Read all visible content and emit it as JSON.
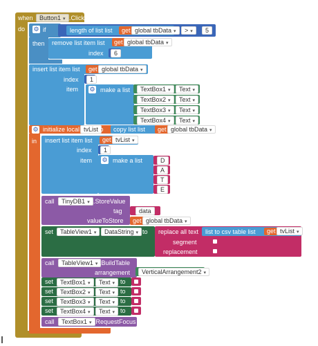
{
  "when_block": {
    "when_label": "when",
    "component": "Button1",
    "event": ".Click",
    "do_label": "do"
  },
  "if_block": {
    "if_label": "if",
    "then_label": "then"
  },
  "length_block": {
    "label": "length of list  list"
  },
  "get_label": "get",
  "global_tbData": "global tbData",
  "compare": {
    "op": ">",
    "value": "5"
  },
  "remove_block": {
    "label": "remove list item  list",
    "index_label": "index",
    "index_value": "6"
  },
  "insert1": {
    "label": "insert list item  list",
    "index_label": "index",
    "index_value": "1",
    "item_label": "item"
  },
  "make_list_label": "make a list",
  "textbox_rows": [
    {
      "component": "TextBox1",
      "prop": "Text"
    },
    {
      "component": "TextBox2",
      "prop": "Text"
    },
    {
      "component": "TextBox3",
      "prop": "Text"
    },
    {
      "component": "TextBox4",
      "prop": "Text"
    }
  ],
  "init_local": {
    "label": "initialize local",
    "var": "tvList",
    "to_label": "to",
    "copy_label": "copy list  list",
    "in_label": "in"
  },
  "insert2": {
    "label": "insert list item  list",
    "var": "tvList",
    "index_label": "index",
    "index_value": "1",
    "item_label": "item"
  },
  "letters": [
    "D",
    "A",
    "T",
    "E"
  ],
  "store_value": {
    "call_label": "call",
    "component": "TinyDB1",
    "method": ".StoreValue",
    "tag_label": "tag",
    "tag_value": "data",
    "value_label": "valueToStore"
  },
  "set_table": {
    "set_label": "set",
    "component": "TableView1",
    "prop": "DataString",
    "to_label": "to",
    "replace_label": "replace all text",
    "csv_label": "list to csv table  list",
    "var": "tvList",
    "segment_label": "segment",
    "replacement_label": "replacement"
  },
  "build_table": {
    "call_label": "call",
    "component": "TableView1",
    "method": ".BuildTable",
    "arrangement_label": "arrangement",
    "arrangement_value": "VerticalArrangement2"
  },
  "set_textboxes": [
    {
      "set_label": "set",
      "component": "TextBox1",
      "prop": "Text",
      "to_label": "to"
    },
    {
      "set_label": "set",
      "component": "TextBox2",
      "prop": "Text",
      "to_label": "to"
    },
    {
      "set_label": "set",
      "component": "TextBox3",
      "prop": "Text",
      "to_label": "to"
    },
    {
      "set_label": "set",
      "component": "TextBox4",
      "prop": "Text",
      "to_label": "to"
    }
  ],
  "focus": {
    "call_label": "call",
    "component": "TextBox1",
    "method": ".RequestFocus"
  },
  "colors": {
    "event": "#b08f2a",
    "control": "#4a8fc4",
    "list": "#4a9cd4",
    "variable": "#e3672e",
    "math": "#3a66b8",
    "component": "#3e8b5a",
    "text": "#c22d66",
    "procedure": "#8c5aa6",
    "dark_component": "#2b6d44",
    "db": "#7a4b91"
  }
}
